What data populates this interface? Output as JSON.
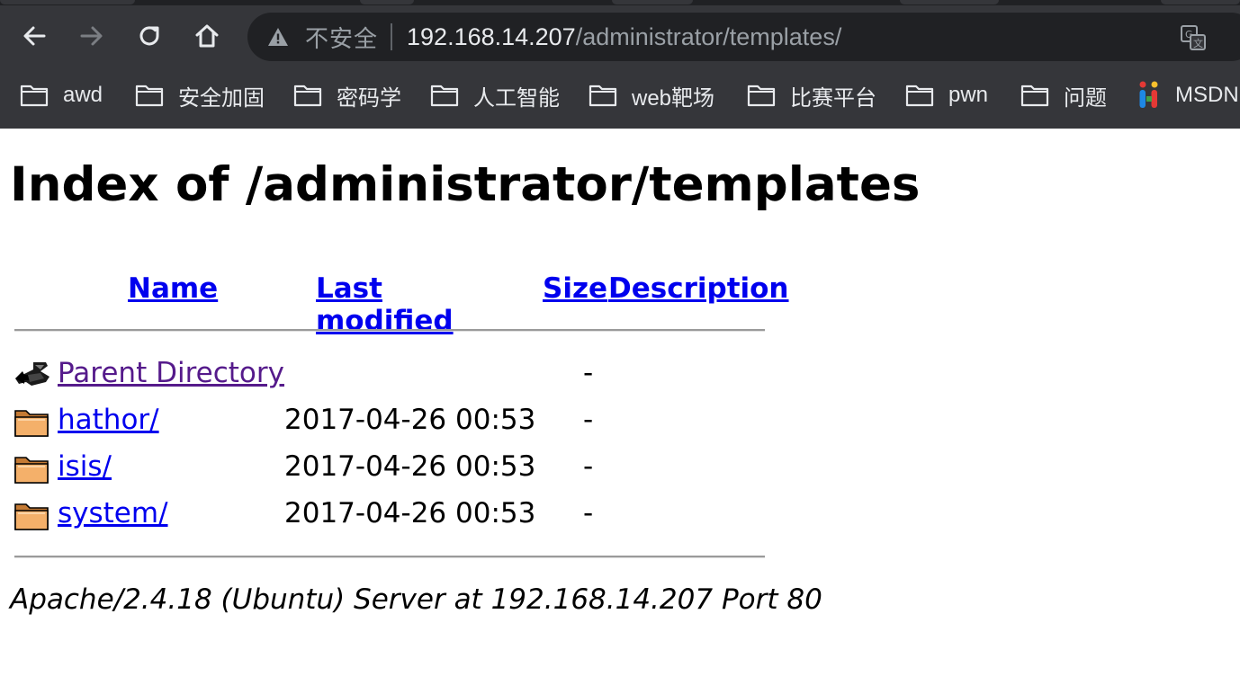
{
  "browser": {
    "insecure_label": "不安全",
    "url_host": "192.168.14.207",
    "url_path": "/administrator/templates/",
    "nav_icons": [
      "back-icon",
      "forward-icon",
      "reload-icon",
      "home-icon"
    ],
    "bookmarks": [
      {
        "label": "awd",
        "icon": "folder-icon"
      },
      {
        "label": "安全加固",
        "icon": "folder-icon"
      },
      {
        "label": "密码学",
        "icon": "folder-icon"
      },
      {
        "label": "人工智能",
        "icon": "folder-icon"
      },
      {
        "label": "web靶场",
        "icon": "folder-icon"
      },
      {
        "label": "比赛平台",
        "icon": "folder-icon"
      },
      {
        "label": "pwn",
        "icon": "folder-icon"
      },
      {
        "label": "问题",
        "icon": "folder-icon"
      },
      {
        "label": "MSDN",
        "icon": "msdn-logo-icon"
      }
    ]
  },
  "page": {
    "title": "Index of /administrator/templates",
    "columns": {
      "name": "Name",
      "last_modified": "Last modified",
      "size": "Size",
      "description": "Description"
    },
    "rows": [
      {
        "icon": "back-arrow-icon",
        "name": "Parent Directory",
        "modified": "",
        "size": "-",
        "description": "",
        "visited": true
      },
      {
        "icon": "folder-icon",
        "name": "hathor/",
        "modified": "2017-04-26 00:53",
        "size": "-",
        "description": "",
        "visited": false
      },
      {
        "icon": "folder-icon",
        "name": "isis/",
        "modified": "2017-04-26 00:53",
        "size": "-",
        "description": "",
        "visited": false
      },
      {
        "icon": "folder-icon",
        "name": "system/",
        "modified": "2017-04-26 00:53",
        "size": "-",
        "description": "",
        "visited": false
      }
    ],
    "server_signature": "Apache/2.4.18 (Ubuntu) Server at 192.168.14.207 Port 80"
  },
  "colors": {
    "chrome_bg": "#35363a",
    "omnibox_bg": "#202124",
    "link": "#0000ee",
    "visited_link": "#551a8b"
  }
}
